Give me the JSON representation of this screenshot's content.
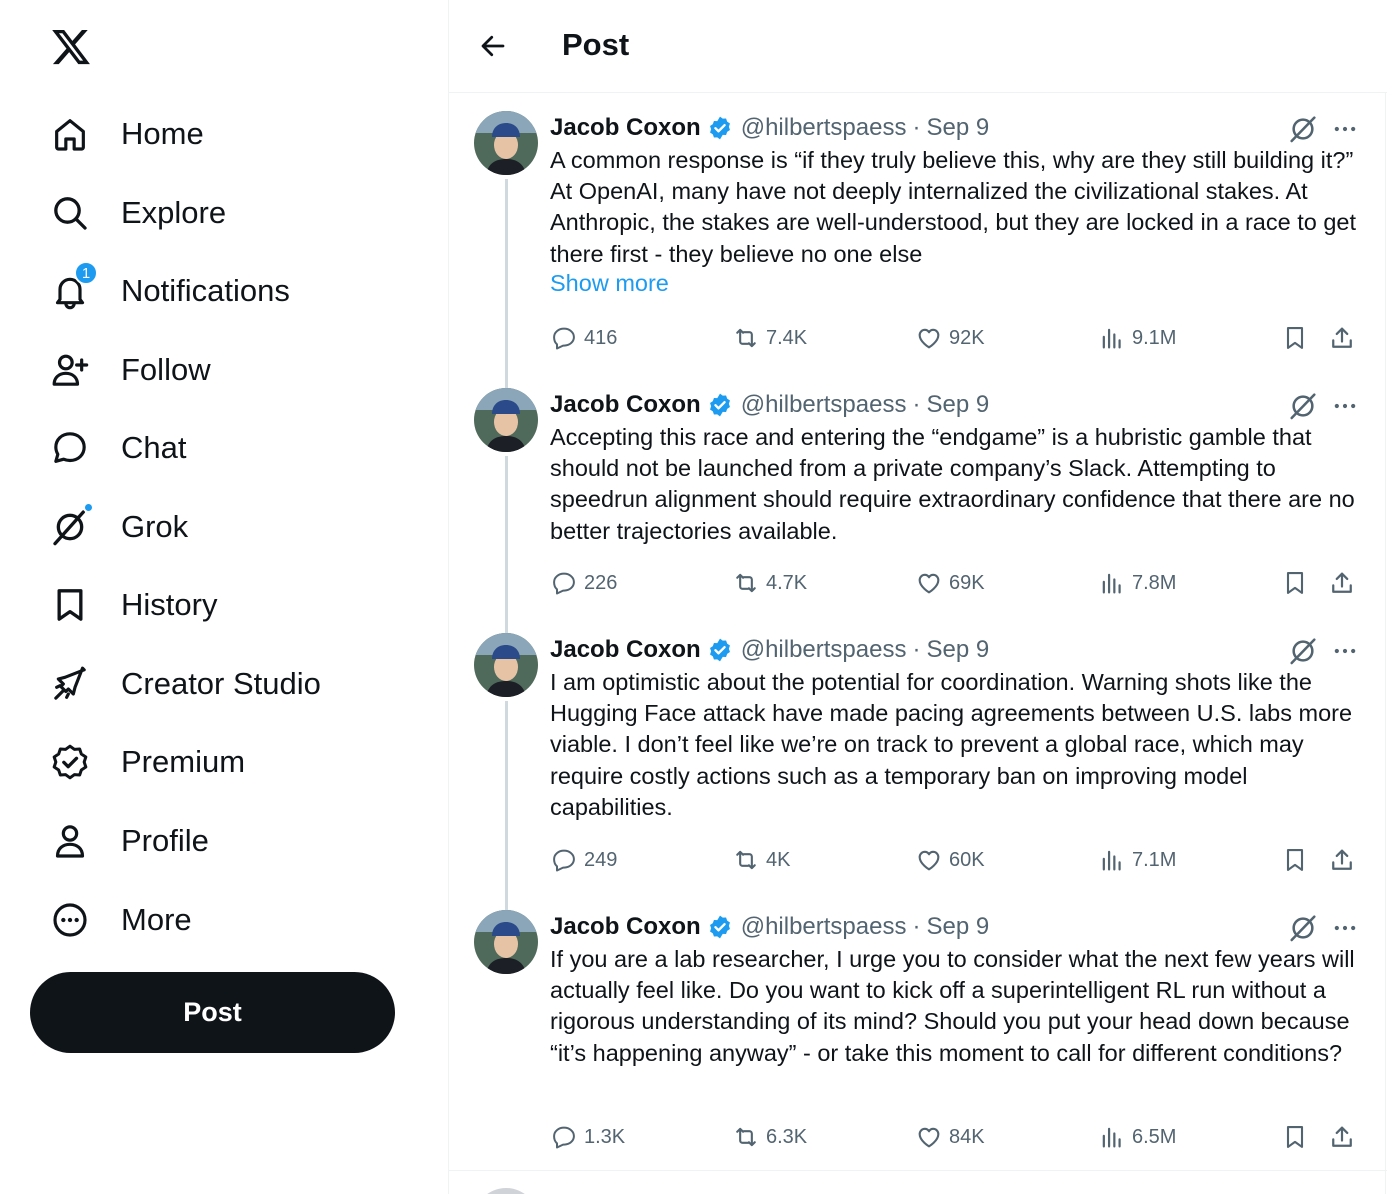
{
  "sidebar": {
    "logo": "x-logo",
    "items": [
      {
        "label": "Home",
        "icon": "home-icon"
      },
      {
        "label": "Explore",
        "icon": "search-icon"
      },
      {
        "label": "Notifications",
        "icon": "bell-icon",
        "badge": "1"
      },
      {
        "label": "Follow",
        "icon": "add-person-icon"
      },
      {
        "label": "Chat",
        "icon": "chat-bubble-icon"
      },
      {
        "label": "Grok",
        "icon": "grok-icon"
      },
      {
        "label": "History",
        "icon": "bookmark-icon"
      },
      {
        "label": "Creator Studio",
        "icon": "rocket-icon"
      },
      {
        "label": "Premium",
        "icon": "verified-badge-icon"
      },
      {
        "label": "Profile",
        "icon": "person-icon"
      },
      {
        "label": "More",
        "icon": "more-circle-icon"
      }
    ],
    "post_button": "Post"
  },
  "header": {
    "title": "Post"
  },
  "colors": {
    "accent": "#1d9bf0",
    "text": "#0f1419",
    "muted": "#536471",
    "border": "#eff3f4"
  },
  "tweets": [
    {
      "name": "Jacob Coxon",
      "handle": "@hilbertspaess",
      "sep": "·",
      "date": "Sep 9",
      "text": "A common response is “if they truly believe this, why are they still building it?” At OpenAI, many have not deeply internalized the civilizational stakes. At Anthropic, the stakes are well-understood, but they are locked in a race to get there first - they believe no one else",
      "show_more": "Show more",
      "replies": "416",
      "reposts": "7.4K",
      "likes": "92K",
      "views": "9.1M"
    },
    {
      "name": "Jacob Coxon",
      "handle": "@hilbertspaess",
      "sep": "·",
      "date": "Sep 9",
      "text": "Accepting this race and entering the “endgame” is a hubristic gamble that should not be launched from a private company’s Slack. Attempting to speedrun alignment should require extraordinary confidence that there are no better trajectories available.",
      "replies": "226",
      "reposts": "4.7K",
      "likes": "69K",
      "views": "7.8M"
    },
    {
      "name": "Jacob Coxon",
      "handle": "@hilbertspaess",
      "sep": "·",
      "date": "Sep 9",
      "text": "I am optimistic about the potential for coordination. Warning shots like the Hugging Face attack have made pacing agreements between U.S. labs more viable. I don’t feel like we’re on track to prevent a global race, which may require costly actions such as a temporary ban on improving model capabilities.",
      "replies": "249",
      "reposts": "4K",
      "likes": "60K",
      "views": "7.1M"
    },
    {
      "name": "Jacob Coxon",
      "handle": "@hilbertspaess",
      "sep": "·",
      "date": "Sep 9",
      "text": "If you are a lab researcher, I urge you to consider what the next few years will actually feel like. Do you want to kick off a superintelligent RL run without a rigorous understanding of its mind? Should you put your head down because “it’s happening anyway” - or take this moment to call for different conditions?",
      "replies": "1.3K",
      "reposts": "6.3K",
      "likes": "84K",
      "views": "6.5M"
    }
  ]
}
